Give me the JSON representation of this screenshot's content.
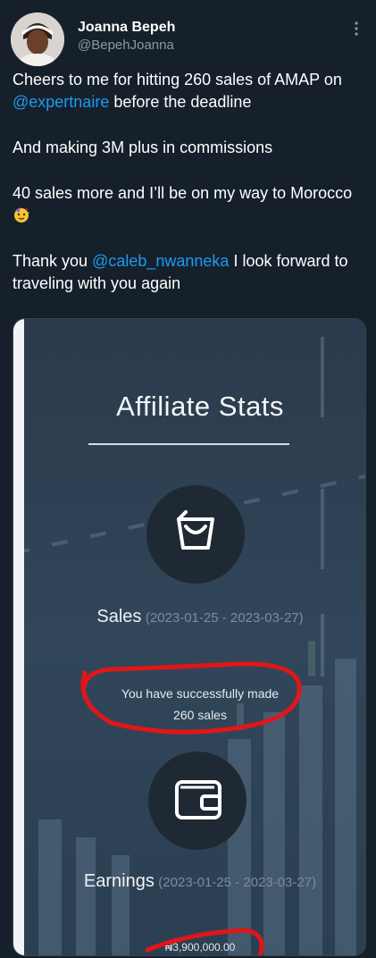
{
  "tweet": {
    "author": {
      "display_name": "Joanna Bepeh",
      "handle": "@BepehJoanna",
      "avatar_icon": "profile-photo"
    },
    "more_icon": "more-vertical-icon",
    "text": {
      "line1_before": "Cheers to me for hitting 260 sales of AMAP on ",
      "line1_mention": "@expertnaire",
      "line1_after": " before the deadline",
      "line2": "And making 3M plus in commissions",
      "line3": "40 sales more and I’ll be on my way to Morocco",
      "line3_emoji": "party-face-emoji",
      "line4_before": "Thank you ",
      "line4_mention": "@caleb_nwanneka",
      "line4_after": " I look forward to traveling with you again"
    },
    "colors": {
      "background": "#15202b",
      "mention": "#1d9bf0",
      "secondary_text": "#8b98a5",
      "annotation_red": "#e0161a"
    }
  },
  "media": {
    "title": "Affiliate Stats",
    "sales": {
      "icon": "shopping-bag-icon",
      "label": "Sales",
      "range": "(2023-01-25 - 2023-03-27)",
      "message_line1": "You have successfully made",
      "message_line2": "260 sales"
    },
    "earnings": {
      "icon": "wallet-icon",
      "label": "Earnings",
      "range": "(2023-01-25 - 2023-03-27)",
      "amount": "₦3,900,000.00"
    }
  }
}
